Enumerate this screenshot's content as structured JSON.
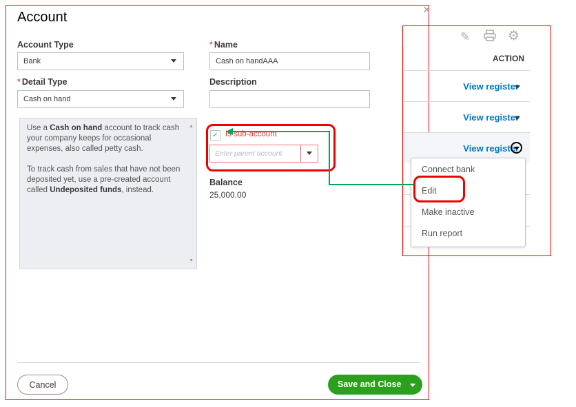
{
  "modal": {
    "title": "Account",
    "close": "×",
    "account_type": {
      "label": "Account Type",
      "value": "Bank"
    },
    "name": {
      "label": "Name",
      "value": "Cash on handAAA"
    },
    "detail_type": {
      "label": "Detail Type",
      "value": "Cash on hand"
    },
    "description": {
      "label": "Description",
      "value": ""
    },
    "help": {
      "p1_a": "Use a ",
      "p1_b": "Cash on hand",
      "p1_c": " account to track cash your company keeps for occasional expenses, also called petty cash.",
      "p2_a": "To track cash from sales that have not been deposited yet, use a pre-created account called ",
      "p2_b": "Undeposited funds",
      "p2_c": ", instead."
    },
    "sub_account": {
      "label": "Is sub-account",
      "checked": true,
      "placeholder": "Enter parent account"
    },
    "balance": {
      "label": "Balance",
      "value": "25,000.00"
    },
    "cancel": "Cancel",
    "save": "Save and Close"
  },
  "panel": {
    "header": "ACTION",
    "rows": [
      "View register",
      "View register",
      "View register"
    ],
    "menu": [
      "Connect bank",
      "Edit",
      "Make inactive",
      "Run report"
    ],
    "icons": [
      "pencil-icon",
      "printer-icon",
      "gear-icon"
    ]
  },
  "colors": {
    "annotation_red": "#e00000",
    "connector_green": "#00a651",
    "save_green": "#2ca01c",
    "link_blue": "#0077c5"
  }
}
